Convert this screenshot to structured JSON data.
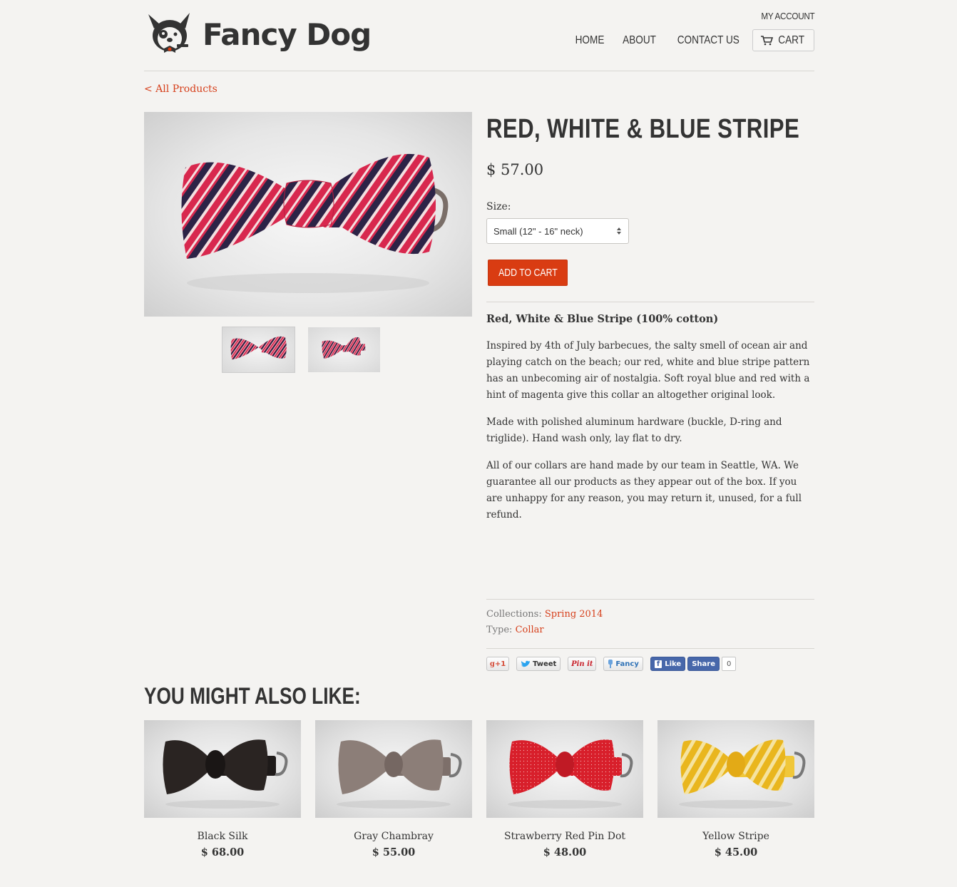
{
  "header": {
    "brand": "Fancy Dog",
    "my_account": "MY ACCOUNT",
    "nav": [
      "HOME",
      "ABOUT",
      "CONTACT US"
    ],
    "cart": "CART"
  },
  "back_link": "< All Products",
  "product": {
    "title": "RED, WHITE & BLUE STRIPE",
    "price": "$ 57.00",
    "size_label": "Size:",
    "size_selected": "Small (12\" - 16\" neck)",
    "add_to_cart": "ADD TO CART",
    "description_heading": "Red, White & Blue Stripe  (100% cotton)",
    "description": [
      "Inspired by 4th of July barbecues, the salty smell of ocean air and playing catch on the beach; our red, white and blue stripe pattern has an unbecoming air of nostalgia. Soft royal blue and red with a hint of magenta give this collar an altogether original look.",
      "Made with polished aluminum hardware (buckle, D-ring and triglide). Hand wash only, lay flat to dry.",
      "All of our collars are hand made by our team in Seattle, WA. We guarantee all our products as they appear out of the box. If you are unhappy for any reason, you may return it, unused, for a full refund."
    ],
    "collections_label": "Collections:",
    "collection": "Spring 2014",
    "type_label": "Type:",
    "type": "Collar"
  },
  "social": {
    "gplus": "+1",
    "tweet": "Tweet",
    "pinit": "Pin it",
    "fancy": "Fancy",
    "like": "Like",
    "share": "Share",
    "count": "0"
  },
  "also_like": {
    "heading": "YOU MIGHT ALSO LIKE:",
    "items": [
      {
        "name": "Black Silk",
        "price": "$ 68.00"
      },
      {
        "name": "Gray Chambray",
        "price": "$ 55.00"
      },
      {
        "name": "Strawberry Red Pin Dot",
        "price": "$ 48.00"
      },
      {
        "name": "Yellow Stripe",
        "price": "$ 45.00"
      }
    ]
  },
  "colors": {
    "accent": "#d93c12",
    "link": "#d6401c",
    "background": "#f4f3f1"
  }
}
